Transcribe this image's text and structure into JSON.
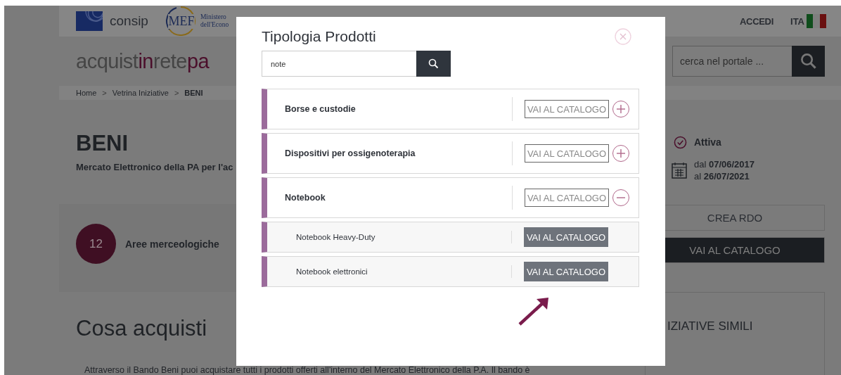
{
  "header": {
    "brand": "consip",
    "ministry_logo": "MEF",
    "ministry_lines": [
      "Ministero",
      "dell'Econo"
    ],
    "login": "ACCEDI",
    "language": "ITA"
  },
  "site_logo": [
    {
      "text": "acquist",
      "accent": false
    },
    {
      "text": "in",
      "accent": true
    },
    {
      "text": "rete",
      "accent": false
    },
    {
      "text": "pa",
      "accent": true
    }
  ],
  "portal_search": {
    "placeholder": "cerca nel portale ..."
  },
  "breadcrumb": {
    "separator": ">",
    "items": [
      {
        "label": "Home",
        "current": false
      },
      {
        "label": "Vetrina Iniziative",
        "current": false
      },
      {
        "label": "BENI",
        "current": true
      }
    ]
  },
  "page": {
    "title": "BENI",
    "subtitle": "Mercato Elettronico della PA per l'ac",
    "status": "Attiva",
    "dates": [
      "dal **07/06/2017**",
      "al **26/07/2021**"
    ],
    "count": "12",
    "count_label": "Aree merceologiche",
    "actions": [
      {
        "label": "CREA RDO",
        "primary": false
      },
      {
        "label": "VAI AL CATALOGO",
        "primary": true
      }
    ],
    "section_title": "Cosa acquisti",
    "paragraph": "Attraverso il Bando Beni puoi acquistare tutti i prodotti offerti all'interno del Mercato Elettronico della P.A. Il bando è",
    "side_box_title": "IZIATIVE SIMILI"
  },
  "modal": {
    "title": "Tipologia Prodotti",
    "search_value": "note",
    "items": [
      {
        "label": "Borse e custodie",
        "catalog_label": "VAI AL CATALOGO",
        "expanded": false
      },
      {
        "label": "Dispositivi per ossigenoterapia",
        "catalog_label": "VAI AL CATALOGO",
        "expanded": false
      },
      {
        "label": "Notebook",
        "catalog_label": "VAI AL CATALOGO",
        "expanded": true,
        "children": [
          {
            "label": "Notebook Heavy-Duty",
            "catalog_label": "VAI AL CATALOGO"
          },
          {
            "label": "Notebook elettronici",
            "catalog_label": "VAI AL CATALOGO"
          }
        ]
      }
    ]
  }
}
